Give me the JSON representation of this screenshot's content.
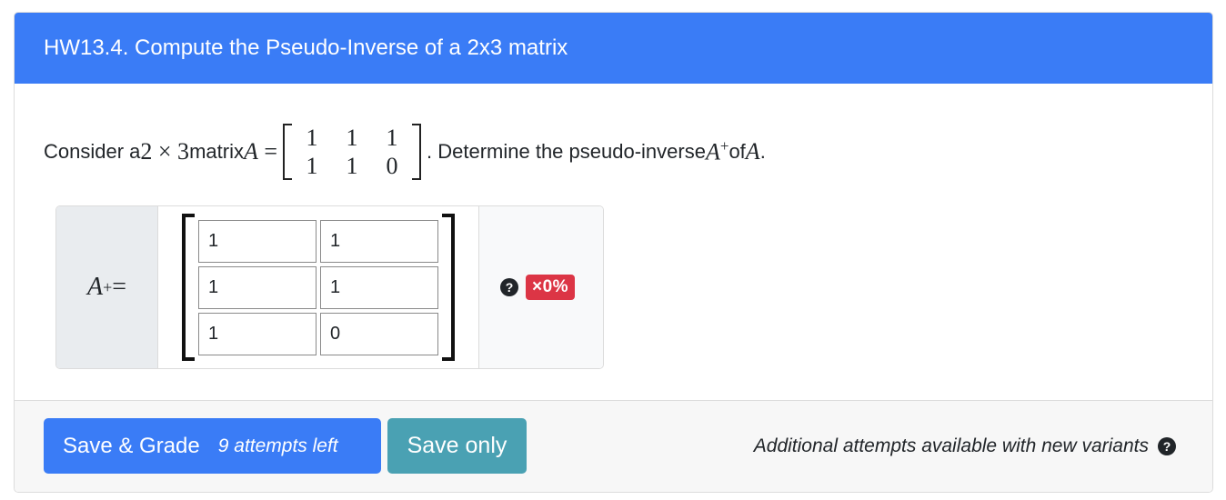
{
  "header": {
    "title": "HW13.4. Compute the Pseudo-Inverse of a 2x3 matrix"
  },
  "question": {
    "text_pre": "Consider a ",
    "dims": "2 × 3",
    "text_matrix": " matrix ",
    "var": "A",
    "equals": " = ",
    "matrix": [
      [
        "1",
        "1",
        "1"
      ],
      [
        "1",
        "1",
        "0"
      ]
    ],
    "text_post": ". Determine the pseudo-inverse ",
    "pinv_var": "A",
    "pinv_sup": "+",
    "text_of": " of ",
    "end_var": "A",
    "end_punct": "."
  },
  "answer": {
    "label_var": "A",
    "label_sup": "+",
    "label_eq": " =",
    "cells": [
      [
        "1",
        "1"
      ],
      [
        "1",
        "1"
      ],
      [
        "1",
        "0"
      ]
    ],
    "help_icon": "question-circle-icon",
    "status_badge": "×0%"
  },
  "footer": {
    "save_grade_label": "Save & Grade",
    "attempts_left": "9 attempts left",
    "save_only_label": "Save only",
    "additional_attempts": "Additional attempts available with new variants",
    "info_icon": "question-circle-icon"
  },
  "colors": {
    "header_bg": "#3a7cf6",
    "save_only_bg": "#4aa1b3",
    "badge_bg": "#dc3545"
  }
}
